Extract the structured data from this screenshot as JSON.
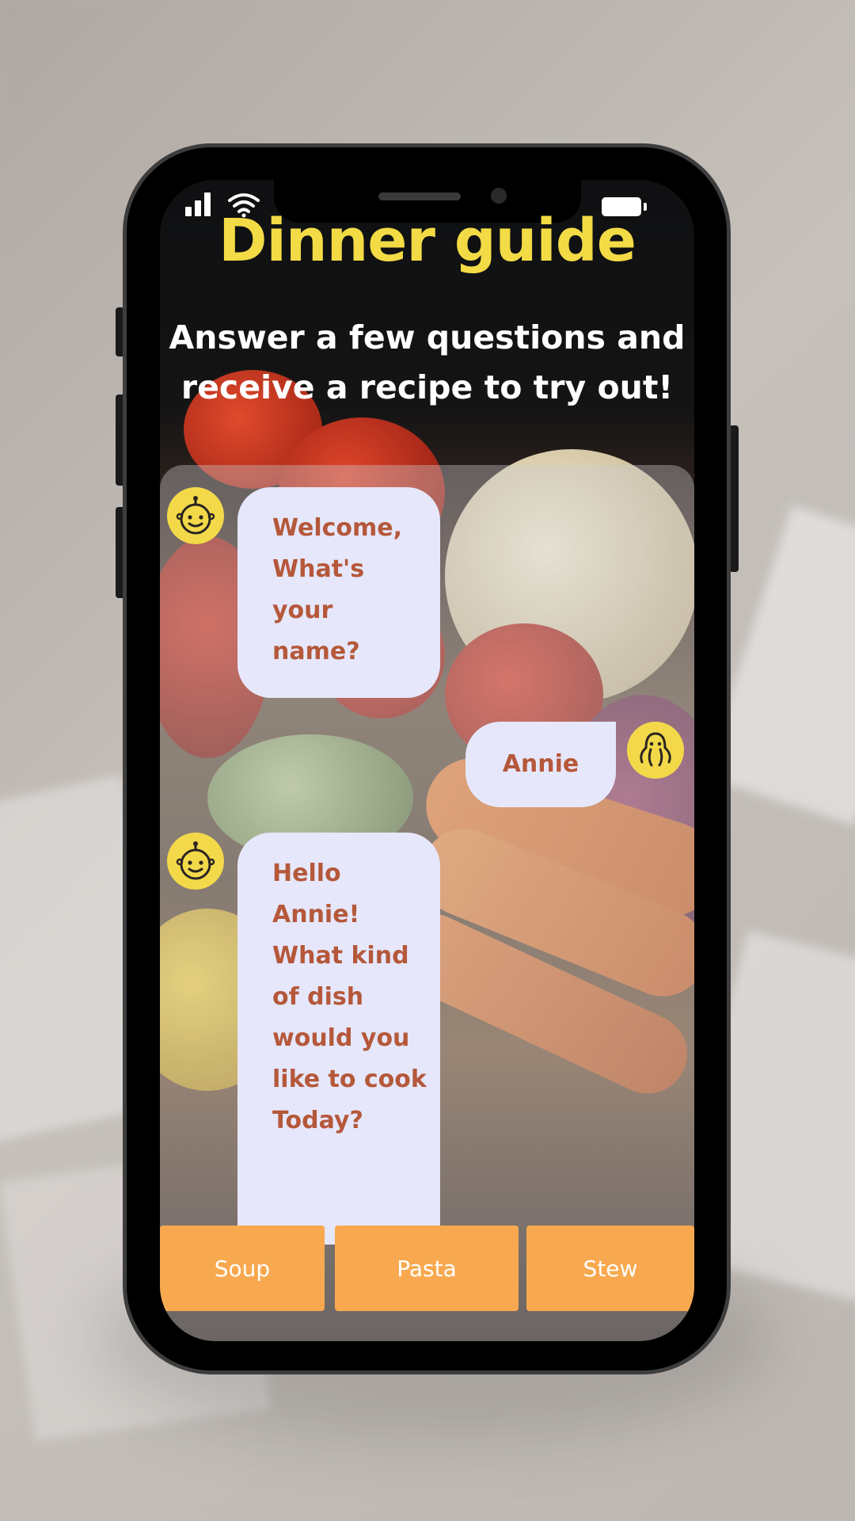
{
  "app": {
    "title": "Dinner guide",
    "subtitle": "Answer a few questions and receive a recipe to try out!"
  },
  "chat": [
    {
      "sender": "bot",
      "avatar": "robot-face-icon",
      "text": "Welcome, What's your name?"
    },
    {
      "sender": "user",
      "avatar": "octopus-icon",
      "text": "Annie"
    },
    {
      "sender": "bot",
      "avatar": "robot-face-icon",
      "text": "Hello Annie! What kind of dish would you like to cook Today?"
    }
  ],
  "options": [
    "Soup",
    "Pasta",
    "Stew"
  ],
  "colors": {
    "title": "#f2db45",
    "bubble_bg": "#e6e7fb",
    "bubble_text": "#b5583a",
    "avatar_bg": "#f3d94a",
    "option_bg": "#f8a94f"
  },
  "status_bar": {
    "icons": [
      "signal-icon",
      "wifi-icon",
      "battery-icon"
    ]
  }
}
